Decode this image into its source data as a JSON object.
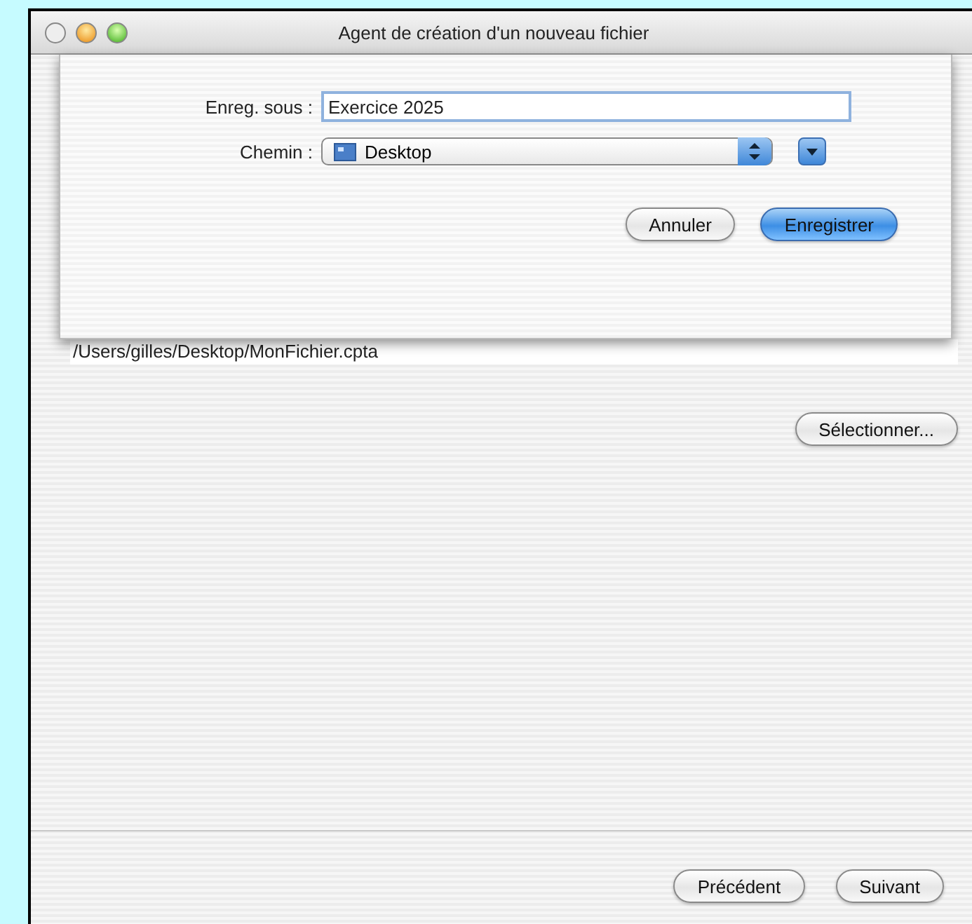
{
  "window": {
    "title": "Agent de création d'un nouveau fichier"
  },
  "save_sheet": {
    "save_as_label": "Enreg. sous :",
    "save_as_value": "Exercice 2025",
    "path_label": "Chemin :",
    "path_value": "Desktop",
    "buttons": [
      {
        "label": "Annuler",
        "kind": "normal"
      },
      {
        "label": "Enregistrer",
        "kind": "default"
      }
    ]
  },
  "file_path": "/Users/gilles/Desktop/MonFichier.cpta",
  "select_button": "Sélectionner...",
  "nav_buttons": [
    {
      "label": "Précédent",
      "kind": "normal"
    },
    {
      "label": "Suivant",
      "kind": "normal"
    }
  ]
}
